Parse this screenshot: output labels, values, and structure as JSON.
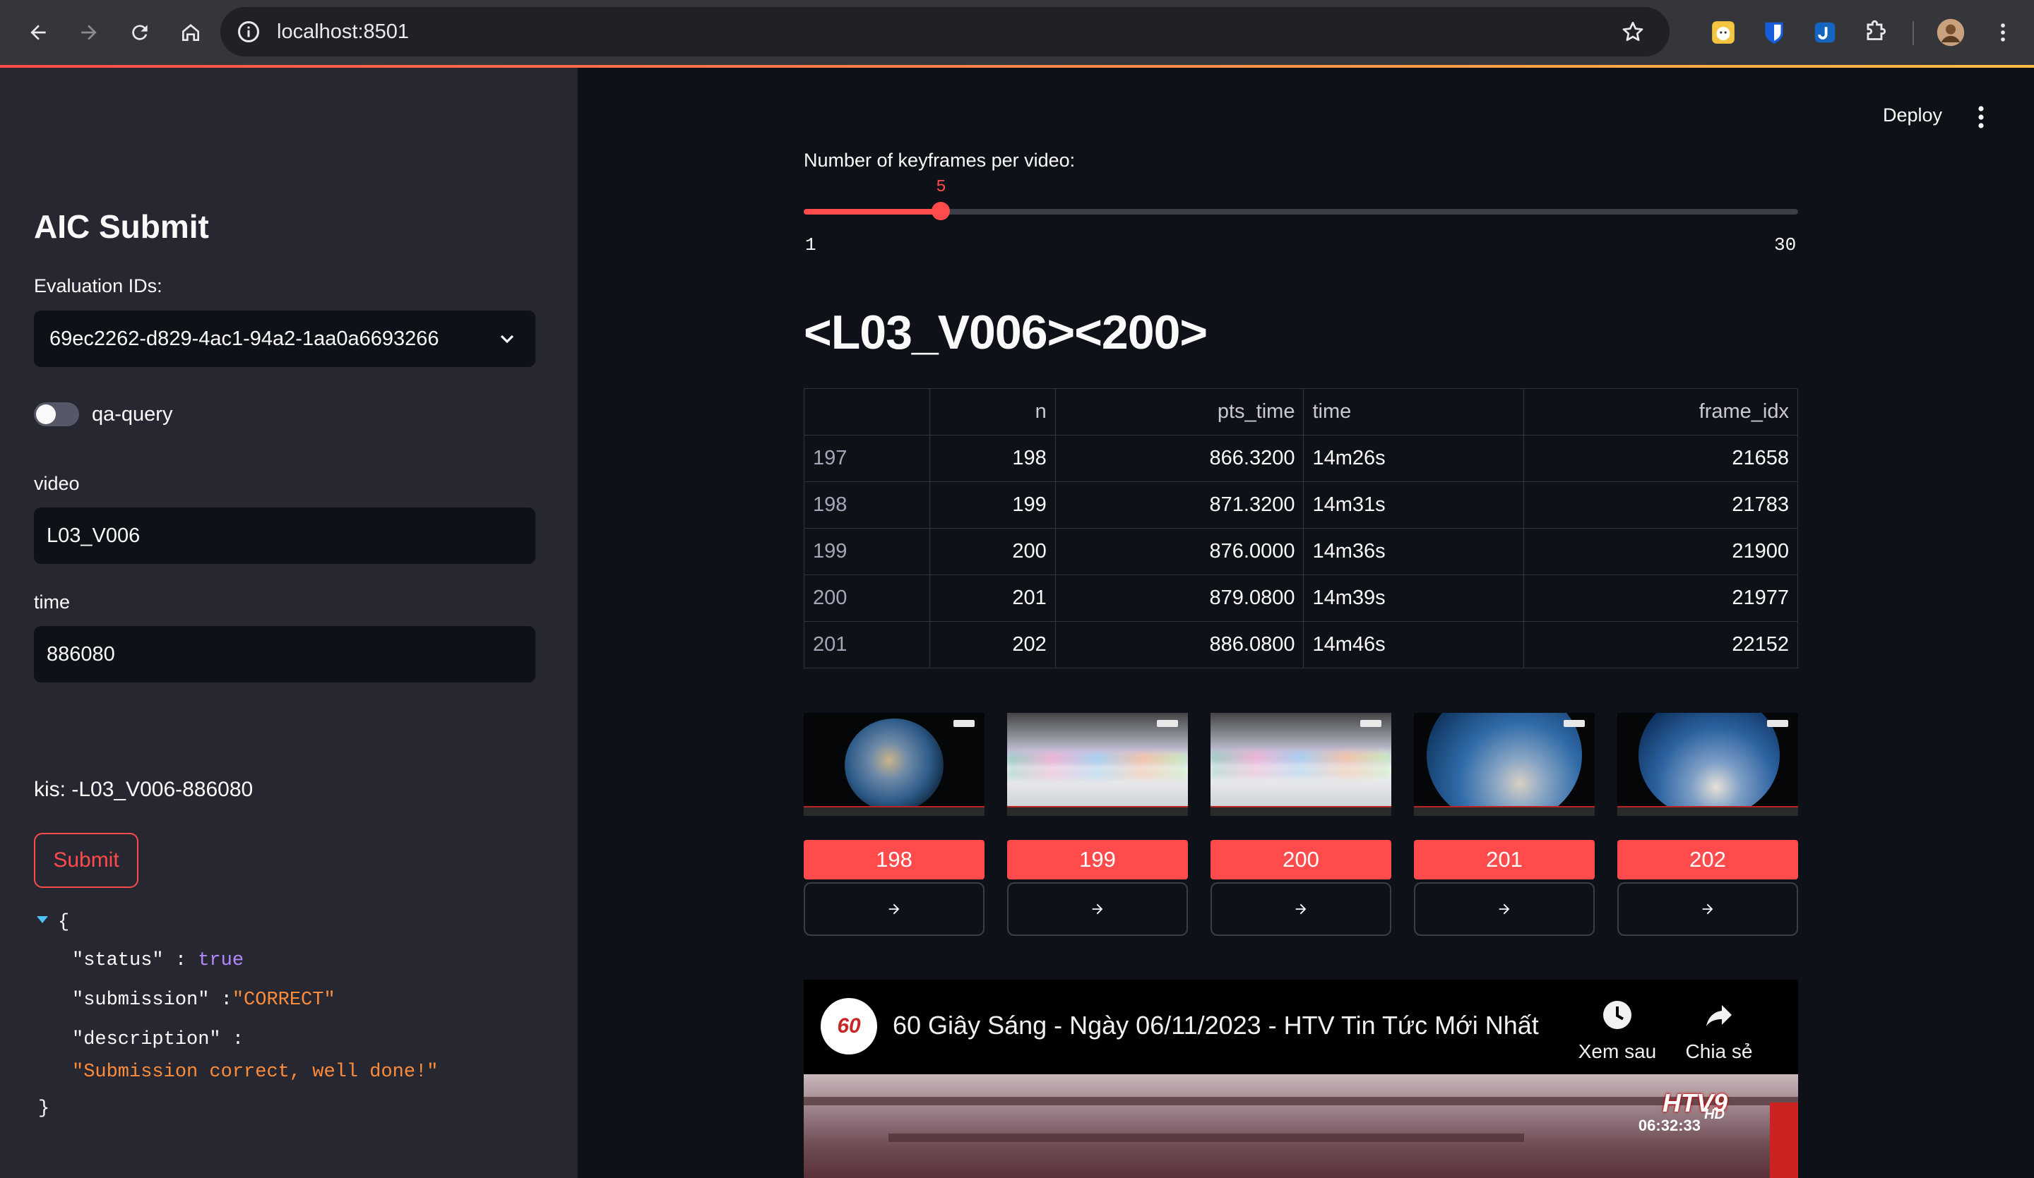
{
  "browser": {
    "url": "localhost:8501"
  },
  "sidebar": {
    "title": "AIC Submit",
    "eval_label": "Evaluation IDs:",
    "eval_value": "69ec2262-d829-4ac1-94a2-1aa0a6693266",
    "toggle_label": "qa-query",
    "toggle_on": false,
    "video_label": "video",
    "video_value": "L03_V006",
    "time_label": "time",
    "time_value": "886080",
    "kis_text": "kis: -L03_V006-886080",
    "submit_label": "Submit",
    "response": {
      "open_brace": "{",
      "close_brace": "}",
      "status_key": "\"status\" :",
      "status_val": "true",
      "submission_key": "\"submission\" :",
      "submission_val": "\"CORRECT\"",
      "description_key": "\"description\" :",
      "description_val": "\"Submission correct, well done!\""
    }
  },
  "header": {
    "deploy_label": "Deploy"
  },
  "slider": {
    "label": "Number of keyframes per video:",
    "value": 5,
    "min": 1,
    "max": 30
  },
  "heading": "<L03_V006><200>",
  "table": {
    "columns": [
      "",
      "n",
      "pts_time",
      "time",
      "frame_idx"
    ],
    "rows": [
      [
        "197",
        "198",
        "866.3200",
        "14m26s",
        "21658"
      ],
      [
        "198",
        "199",
        "871.3200",
        "14m31s",
        "21783"
      ],
      [
        "199",
        "200",
        "876.0000",
        "14m36s",
        "21900"
      ],
      [
        "200",
        "201",
        "879.0800",
        "14m39s",
        "21977"
      ],
      [
        "201",
        "202",
        "886.0800",
        "14m46s",
        "22152"
      ]
    ]
  },
  "frames": [
    {
      "label": "198",
      "scene": "earth-africa"
    },
    {
      "label": "199",
      "scene": "sky"
    },
    {
      "label": "200",
      "scene": "sky"
    },
    {
      "label": "201",
      "scene": "earth-closeup"
    },
    {
      "label": "202",
      "scene": "earth-closeup"
    }
  ],
  "frame_button_icon": "arrow-right-icon",
  "player": {
    "channel_logo": "60",
    "title": "60 Giây Sáng - Ngày 06/11/2023 - HTV Tin Tức Mới Nhất",
    "watch_later": "Xem sau",
    "share": "Chia sẻ",
    "station_logo": "HTV9",
    "hd": "HD",
    "clock": "06:32:33"
  },
  "colors": {
    "accent": "#ff4b4b",
    "sidebar_bg": "#262730",
    "main_bg": "#0e1117"
  }
}
